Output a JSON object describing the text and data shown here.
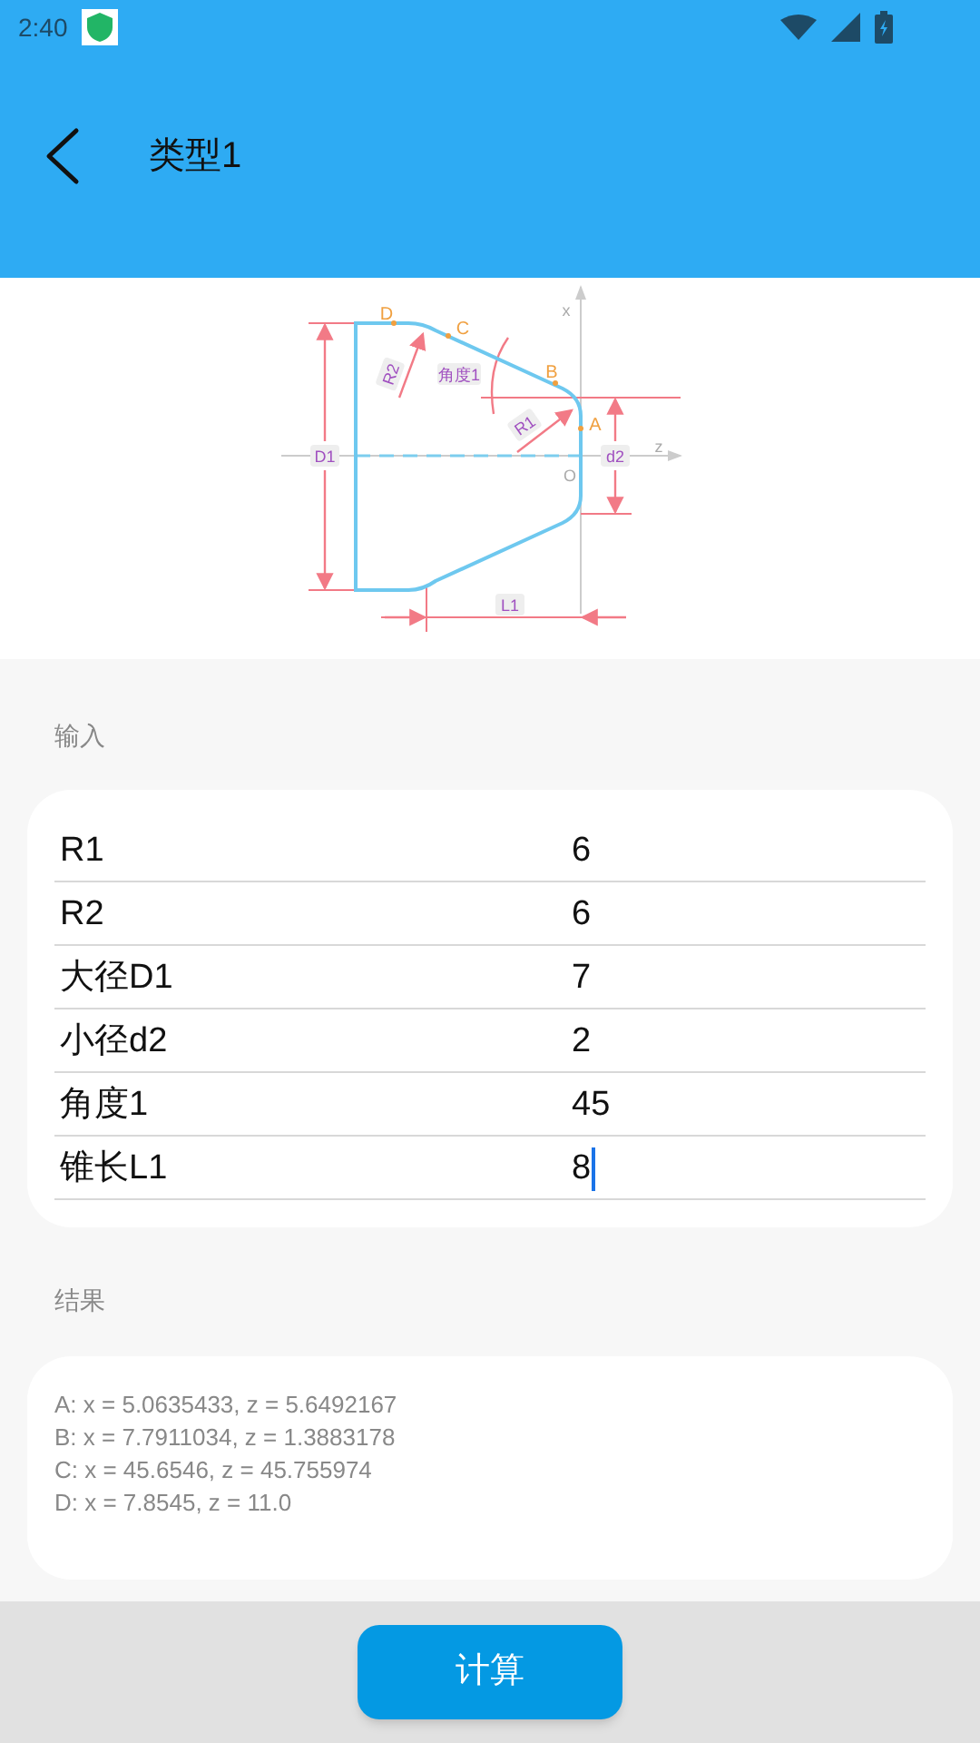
{
  "status_bar": {
    "time": "2:40"
  },
  "header": {
    "title": "类型1"
  },
  "diagram": {
    "labels": [
      "D",
      "C",
      "B",
      "A",
      "x",
      "z",
      "O",
      "D1",
      "d2",
      "L1",
      "R1",
      "R2",
      "角度1"
    ]
  },
  "input_section": {
    "title": "输入",
    "rows": [
      {
        "label": "R1",
        "value": "6",
        "focused": false
      },
      {
        "label": "R2",
        "value": "6",
        "focused": false
      },
      {
        "label": "大径D1",
        "value": "7",
        "focused": false
      },
      {
        "label": "小径d2",
        "value": "2",
        "focused": false
      },
      {
        "label": "角度1",
        "value": "45",
        "focused": false
      },
      {
        "label": "锥长L1",
        "value": "8",
        "focused": true
      }
    ]
  },
  "result_section": {
    "title": "结果",
    "lines": [
      "A: x = 5.0635433, z = 5.6492167",
      "B: x = 7.7911034, z = 1.3883178",
      "C: x = 45.6546, z = 45.755974",
      "D: x = 7.8545, z = 11.0"
    ]
  },
  "button": {
    "label": "计算"
  }
}
